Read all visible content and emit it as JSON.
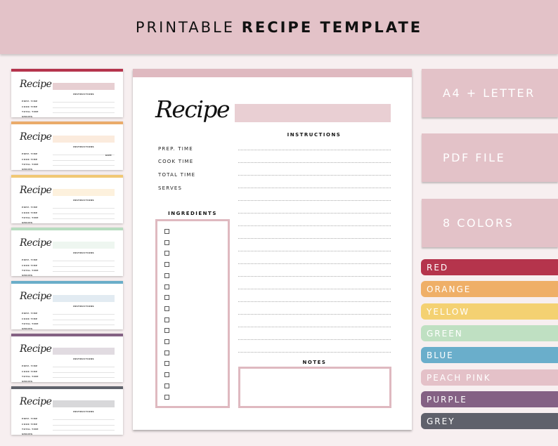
{
  "header": {
    "title_light": "PRINTABLE",
    "title_bold": "RECIPE TEMPLATE",
    "background": "#e3c2c8"
  },
  "thumbnails": [
    {
      "color": "#b5344c",
      "title_box": "#e7cfd2",
      "recipe": "Recipe",
      "instructions": "INSTRUCTIONS",
      "labels": [
        "PREP. TIME",
        "COOK TIME",
        "TOTAL TIME",
        "SERVES"
      ],
      "date": ""
    },
    {
      "color": "#eaab6a",
      "title_box": "#fbebdd",
      "recipe": "Recipe",
      "instructions": "INSTRUCTIONS",
      "labels": [
        "PREP. TIME",
        "COOK TIME",
        "TOTAL TIME",
        "SERVES"
      ],
      "date": "DATE"
    },
    {
      "color": "#f1c874",
      "title_box": "#fdf1dd",
      "recipe": "Recipe",
      "instructions": "INSTRUCTIONS",
      "labels": [
        "PREP. TIME",
        "COOK TIME",
        "TOTAL TIME",
        "SERVES"
      ],
      "date": ""
    },
    {
      "color": "#b7dcbf",
      "title_box": "#eef6f0",
      "recipe": "Recipe",
      "instructions": "INSTRUCTIONS",
      "labels": [
        "PREP. TIME",
        "COOK TIME",
        "TOTAL TIME",
        "SERVES"
      ],
      "date": ""
    },
    {
      "color": "#6aaec9",
      "title_box": "#e2ebf2",
      "recipe": "Recipe",
      "instructions": "INSTRUCTIONS",
      "labels": [
        "PREP. TIME",
        "COOK TIME",
        "TOTAL TIME",
        "SERVES"
      ],
      "date": ""
    },
    {
      "color": "#846183",
      "title_box": "#e1dbe1",
      "recipe": "Recipe",
      "instructions": "INSTRUCTIONS",
      "labels": [
        "PREP. TIME",
        "COOK TIME",
        "TOTAL TIME",
        "SERVES"
      ],
      "date": ""
    },
    {
      "color": "#5f626b",
      "title_box": "#d8d8da",
      "recipe": "Recipe",
      "instructions": "INSTRUCTIONS",
      "labels": [
        "PREP. TIME",
        "COOK TIME",
        "TOTAL TIME",
        "SERVES"
      ],
      "date": ""
    }
  ],
  "page": {
    "accent": "#dfb9c0",
    "recipe_title": "Recipe",
    "instructions_label": "INSTRUCTIONS",
    "meta_labels": [
      "PREP. TIME",
      "COOK TIME",
      "TOTAL TIME",
      "SERVES"
    ],
    "ingredients_label": "INGREDIENTS",
    "ingredient_checkbox_count": 16,
    "instruction_line_count": 17,
    "notes_label": "NOTES"
  },
  "features": [
    "A4 + LETTER",
    "PDF FILE",
    "8 COLORS"
  ],
  "colors": [
    {
      "name": "RED",
      "hex": "#b5344c"
    },
    {
      "name": "ORANGE",
      "hex": "#efaf67"
    },
    {
      "name": "YELLOW",
      "hex": "#f4d172"
    },
    {
      "name": "GREEN",
      "hex": "#bfe0c2"
    },
    {
      "name": "BLUE",
      "hex": "#6aaecb"
    },
    {
      "name": "PEACH PINK",
      "hex": "#e4c1c8"
    },
    {
      "name": "PURPLE",
      "hex": "#846184"
    },
    {
      "name": "GREY",
      "hex": "#5f616b"
    }
  ]
}
